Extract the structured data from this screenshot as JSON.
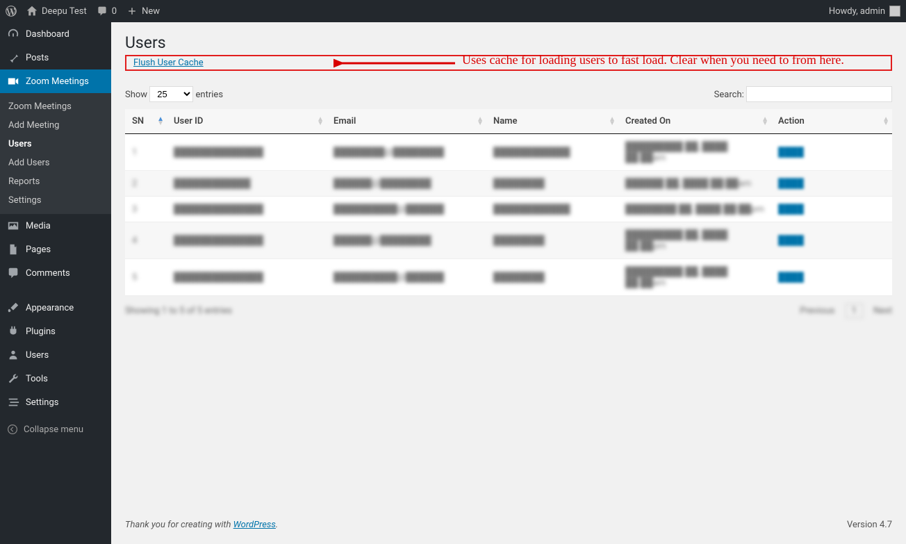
{
  "adminbar": {
    "site_name": "Deepu Test",
    "comments": "0",
    "new": "New",
    "howdy": "Howdy, admin"
  },
  "sidebar": {
    "dashboard": "Dashboard",
    "posts": "Posts",
    "zoom": "Zoom Meetings",
    "zoom_sub": {
      "meetings": "Zoom Meetings",
      "add_meeting": "Add Meeting",
      "users": "Users",
      "add_users": "Add Users",
      "reports": "Reports",
      "settings": "Settings"
    },
    "media": "Media",
    "pages": "Pages",
    "comments": "Comments",
    "appearance": "Appearance",
    "plugins": "Plugins",
    "users": "Users",
    "tools": "Tools",
    "settings": "Settings",
    "collapse": "Collapse menu"
  },
  "page": {
    "title": "Users",
    "flush_label": "Flush User Cache",
    "annotation": "Uses cache for loading users to fast load. Clear when you need to from here."
  },
  "datatable": {
    "show_prefix": "Show",
    "show_suffix": "entries",
    "show_value": "25",
    "search_label": "Search:",
    "cols": {
      "sn": "SN",
      "user_id": "User ID",
      "email": "Email",
      "name": "Name",
      "created": "Created On",
      "action": "Action"
    },
    "rows": [
      {
        "sn": "1",
        "user_id": "██████████████",
        "email": "████████@████████",
        "name": "████████████",
        "created": "█████████ ██, ████ ██:██am",
        "action": "████"
      },
      {
        "sn": "2",
        "user_id": "████████████",
        "email": "██████@████████",
        "name": "████████",
        "created": "██████ ██, ████ ██:██am",
        "action": "████"
      },
      {
        "sn": "3",
        "user_id": "██████████████",
        "email": "██████████@██████",
        "name": "████████████",
        "created": "████████ ██, ████ ██:██pm",
        "action": "████"
      },
      {
        "sn": "4",
        "user_id": "██████████████",
        "email": "██████@████████",
        "name": "████████",
        "created": "█████████ ██, ████ ██:██pm",
        "action": "████"
      },
      {
        "sn": "5",
        "user_id": "██████████████",
        "email": "██████████@██████",
        "name": "████████",
        "created": "█████████ ██, ████ ██:██am",
        "action": "████"
      }
    ],
    "info": "Showing 1 to 5 of 5 entries",
    "prev": "Previous",
    "page": "1",
    "next": "Next"
  },
  "footer": {
    "thanks_prefix": "Thank you for creating with ",
    "thanks_link": "WordPress",
    "thanks_suffix": ".",
    "version": "Version 4.7"
  }
}
